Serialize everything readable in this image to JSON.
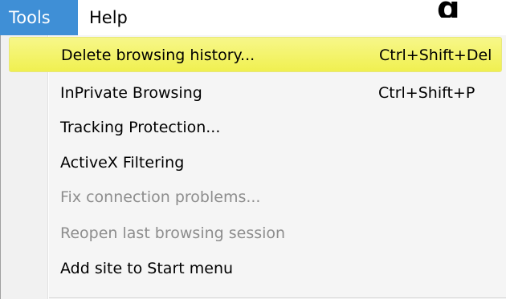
{
  "menubar": {
    "items": [
      {
        "label": "Tools",
        "active": true
      },
      {
        "label": "Help",
        "active": false
      }
    ],
    "partial_text": "g"
  },
  "dropdown": {
    "items": [
      {
        "label": "Delete browsing history...",
        "shortcut": "Ctrl+Shift+Del",
        "state": "highlighted"
      },
      {
        "label": "InPrivate Browsing",
        "shortcut": "Ctrl+Shift+P",
        "state": "enabled"
      },
      {
        "label": "Tracking Protection...",
        "shortcut": "",
        "state": "enabled"
      },
      {
        "label": "ActiveX Filtering",
        "shortcut": "",
        "state": "enabled"
      },
      {
        "label": "Fix connection problems...",
        "shortcut": "",
        "state": "disabled"
      },
      {
        "label": "Reopen last browsing session",
        "shortcut": "",
        "state": "disabled"
      },
      {
        "label": "Add site to Start menu",
        "shortcut": "",
        "state": "enabled"
      }
    ]
  },
  "colors": {
    "active_menu_bg": "#3f8fd6",
    "highlight_bg": "#f0f050",
    "disabled_text": "#8d8d8d"
  }
}
